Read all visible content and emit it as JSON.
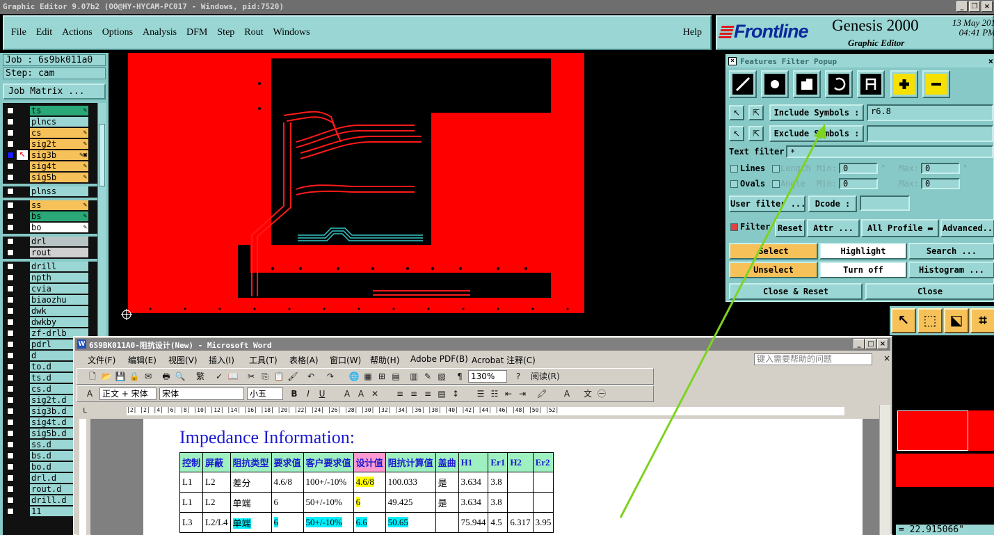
{
  "window": {
    "title": "Graphic Editor 9.07b2 (OO@HY-HYCAM-PC017 - Windows, pid:7520)"
  },
  "menubar": {
    "items": [
      "File",
      "Edit",
      "Actions",
      "Options",
      "Analysis",
      "DFM",
      "Step",
      "Rout",
      "Windows"
    ],
    "help": "Help"
  },
  "brand": {
    "logo": "Frontline",
    "product": "Genesis 2000",
    "subtitle": "Graphic Editor",
    "date": "13 May 201",
    "time": "04:41 PM"
  },
  "job": {
    "job_label": "Job : 6s9bk011a0",
    "step_label": "Step: cam",
    "matrix_button": "Job Matrix ..."
  },
  "layers": [
    {
      "name": "ts",
      "color": "#2aa878",
      "tag": "✎",
      "group": 1
    },
    {
      "name": "plncs",
      "color": "#9ad6d3",
      "tag": "",
      "group": 1
    },
    {
      "name": "cs",
      "color": "#f7c15a",
      "tag": "✎",
      "group": 1
    },
    {
      "name": "sig2t",
      "color": "#f7c15a",
      "tag": "✎",
      "group": 1
    },
    {
      "name": "sig3b",
      "color": "#f7c15a",
      "tag": "✎▣",
      "group": 1,
      "selected": true
    },
    {
      "name": "sig4t",
      "color": "#f7c15a",
      "tag": "✎",
      "group": 1
    },
    {
      "name": "sig5b",
      "color": "#f7c15a",
      "tag": "✎",
      "group": 1
    },
    {
      "name": "plnss",
      "color": "#9ad6d3",
      "tag": "",
      "group": 2
    },
    {
      "name": "ss",
      "color": "#f7c15a",
      "tag": "✎",
      "group": 3
    },
    {
      "name": "bs",
      "color": "#2aa878",
      "tag": "✎",
      "group": 3
    },
    {
      "name": "bo",
      "color": "#ffffff",
      "tag": "✎",
      "group": 3
    },
    {
      "name": "drl",
      "color": "#b8c4c4",
      "tag": "",
      "group": 4
    },
    {
      "name": "rout",
      "color": "#d0d0d0",
      "tag": "",
      "group": 4
    },
    {
      "name": "drill",
      "color": "#9ad6d3",
      "tag": "",
      "group": 5
    },
    {
      "name": "npth",
      "color": "#9ad6d3",
      "tag": "",
      "group": 5
    },
    {
      "name": "cvia",
      "color": "#9ad6d3",
      "tag": "",
      "group": 5
    },
    {
      "name": "biaozhu",
      "color": "#9ad6d3",
      "tag": "",
      "group": 5
    },
    {
      "name": "dwk",
      "color": "#9ad6d3",
      "tag": "",
      "group": 5
    },
    {
      "name": "dwkby",
      "color": "#9ad6d3",
      "tag": "",
      "group": 5
    },
    {
      "name": "zf-drlb",
      "color": "#9ad6d3",
      "tag": "",
      "group": 5
    },
    {
      "name": "pdrl",
      "color": "#9ad6d3",
      "tag": "",
      "group": 5
    },
    {
      "name": "d",
      "color": "#9ad6d3",
      "tag": "",
      "group": 5
    },
    {
      "name": "to.d",
      "color": "#9ad6d3",
      "tag": "",
      "group": 5
    },
    {
      "name": "ts.d",
      "color": "#9ad6d3",
      "tag": "",
      "group": 5
    },
    {
      "name": "cs.d",
      "color": "#9ad6d3",
      "tag": "",
      "group": 5
    },
    {
      "name": "sig2t.d",
      "color": "#9ad6d3",
      "tag": "",
      "group": 5
    },
    {
      "name": "sig3b.d",
      "color": "#9ad6d3",
      "tag": "",
      "group": 5
    },
    {
      "name": "sig4t.d",
      "color": "#9ad6d3",
      "tag": "",
      "group": 5
    },
    {
      "name": "sig5b.d",
      "color": "#9ad6d3",
      "tag": "",
      "group": 5
    },
    {
      "name": "ss.d",
      "color": "#9ad6d3",
      "tag": "",
      "group": 5
    },
    {
      "name": "bs.d",
      "color": "#9ad6d3",
      "tag": "",
      "group": 5
    },
    {
      "name": "bo.d",
      "color": "#9ad6d3",
      "tag": "",
      "group": 5
    },
    {
      "name": "drl.d",
      "color": "#9ad6d3",
      "tag": "",
      "group": 5
    },
    {
      "name": "rout.d",
      "color": "#9ad6d3",
      "tag": "",
      "group": 5
    },
    {
      "name": "drill.d",
      "color": "#9ad6d3",
      "tag": "",
      "group": 5
    },
    {
      "name": "11",
      "color": "#9ad6d3",
      "tag": "",
      "group": 5
    }
  ],
  "filter_popup": {
    "title": "Features Filter Popup",
    "include_symbols_button": "Include Symbols :",
    "include_symbols_value": "r6.8",
    "exclude_symbols_button": "Exclude Symbols :",
    "exclude_symbols_value": "",
    "text_filter_label": "Text filter",
    "text_filter_value": "*",
    "lines_label": "Lines",
    "ovals_label": "Ovals",
    "length_label": "Length",
    "angle_label": "Angle",
    "min_label": "Min:",
    "max_label": "Max:",
    "length_min": "0",
    "length_max": "0",
    "angle_min": "0",
    "angle_max": "0",
    "unit_mark": "\"",
    "user_filter_button": "User filter ...",
    "dcode_button": "Dcode :",
    "dcode_value": "",
    "filter_toggle": "Filter",
    "reset_button": "Reset",
    "attr_button": "Attr ...",
    "profile_dropdown": "All Profile",
    "advanced_button": "Advanced..",
    "select_button": "Select",
    "highlight_button": "Highlight",
    "search_button": "Search ...",
    "unselect_button": "Unselect",
    "turnoff_button": "Turn off",
    "histogram_button": "Histogram ...",
    "close_reset_button": "Close & Reset",
    "close_button": "Close"
  },
  "coord_readout": "= 22.915066\"",
  "word": {
    "title": "6S9BK011A0-阻抗设计(New) - Microsoft Word",
    "menus": [
      "文件(F)",
      "编辑(E)",
      "视图(V)",
      "插入(I)",
      "工具(T)",
      "表格(A)",
      "窗口(W)",
      "帮助(H)",
      "Adobe PDF(B)",
      "Acrobat 注释(C)"
    ],
    "help_placeholder": "键入需要帮助的问题",
    "zoom": "130%",
    "read_button": "阅读(R)",
    "traditional": "繁",
    "style": "正文 + 宋体",
    "font": "宋体",
    "size": "小五",
    "ruler": "│2│  │2│  │4│  │6│  │8│  │10│  │12│  │14│  │16│  │18│  │20│  │22│  │24│  │26│  │28│  │30│  │32│  │34│  │36│  │38│  │40│  │42│  │44│  │46│  │48│  │50│  │52│",
    "heading": "Impedance Information:",
    "table_headers": [
      "控制",
      "屏蔽",
      "阻抗类型",
      "要求值",
      "客户要求值",
      "设计值",
      "阻抗计算值",
      "盖曲",
      "H1",
      "Er1",
      "H2",
      "Er2"
    ],
    "table_rows": [
      [
        "L1",
        "L2",
        "差分",
        "4.6/8",
        "100+/-10%",
        "4.6/8",
        "100.033",
        "是",
        "3.634",
        "3.8",
        "",
        ""
      ],
      [
        "L1",
        "L2",
        "单端",
        "6",
        "50+/-10%",
        "6",
        "49.425",
        "是",
        "3.634",
        "3.8",
        "",
        ""
      ],
      [
        "L3",
        "L2/L4",
        "单端",
        "6",
        "50+/-10%",
        "6.6",
        "50.65",
        "",
        "75.944",
        "4.5",
        "6.317",
        "3.95"
      ]
    ],
    "colors": {
      "heading": "#1a1ad0",
      "header_bg": "#9ff0c0",
      "design_header_bg": "#ff9ad0",
      "yellow_highlight": "#ffff00",
      "cyan_highlight": "#00f0ff"
    }
  },
  "colors": {
    "gui_cyan": "#9ad6d3",
    "copper_red": "#ff0000",
    "arrow_green": "#7ed321"
  }
}
